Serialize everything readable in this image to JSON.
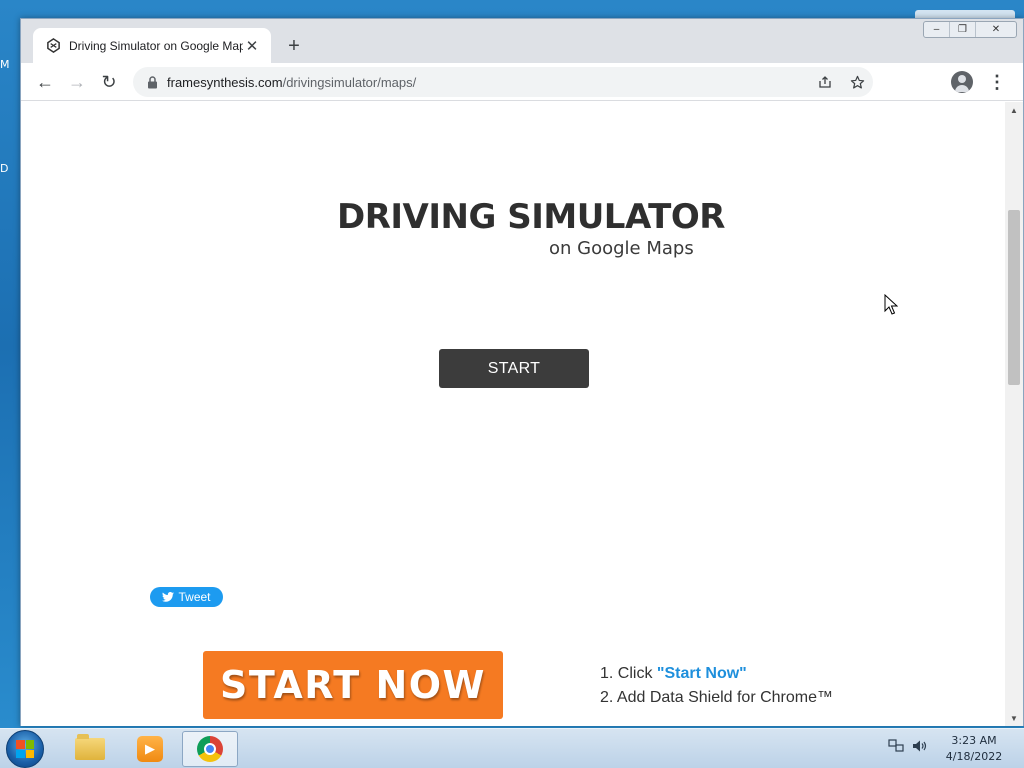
{
  "desktop": {
    "fragment_a": "M",
    "fragment_b": "D"
  },
  "browser": {
    "tab": {
      "title": "Driving Simulator on Google Maps",
      "favicon": "framesynthesis-icon",
      "close_icon": "close-icon"
    },
    "new_tab_icon": "plus-icon",
    "window_controls": {
      "minimize": "–",
      "maximize": "❐",
      "close": "✕"
    },
    "nav": {
      "back": "←",
      "forward": "→",
      "reload": "↻"
    },
    "url": {
      "domain": "framesynthesis.com",
      "path": "/drivingsimulator/maps/"
    },
    "omnibox_icons": [
      "share-icon",
      "star-icon"
    ],
    "menu": "⋮"
  },
  "page": {
    "title": "DRIVING SIMULATOR",
    "subtitle": "on Google Maps",
    "start_button": "START",
    "tweet_button": "Tweet",
    "ad": {
      "button": "START NOW",
      "step1_prefix": "1. Click ",
      "step1_link": "\"Start Now\"",
      "step2": "2. Add Data Shield for Chrome™"
    }
  },
  "taskbar": {
    "items": [
      "windows-explorer",
      "media-player",
      "google-chrome"
    ],
    "clock": {
      "time": "3:23 AM",
      "date": "4/18/2022"
    }
  },
  "colors": {
    "ad_orange": "#f57a22",
    "start_dark": "#3c3c3c",
    "tweet_blue": "#1d9bf0",
    "link_blue": "#1e8fdc"
  }
}
